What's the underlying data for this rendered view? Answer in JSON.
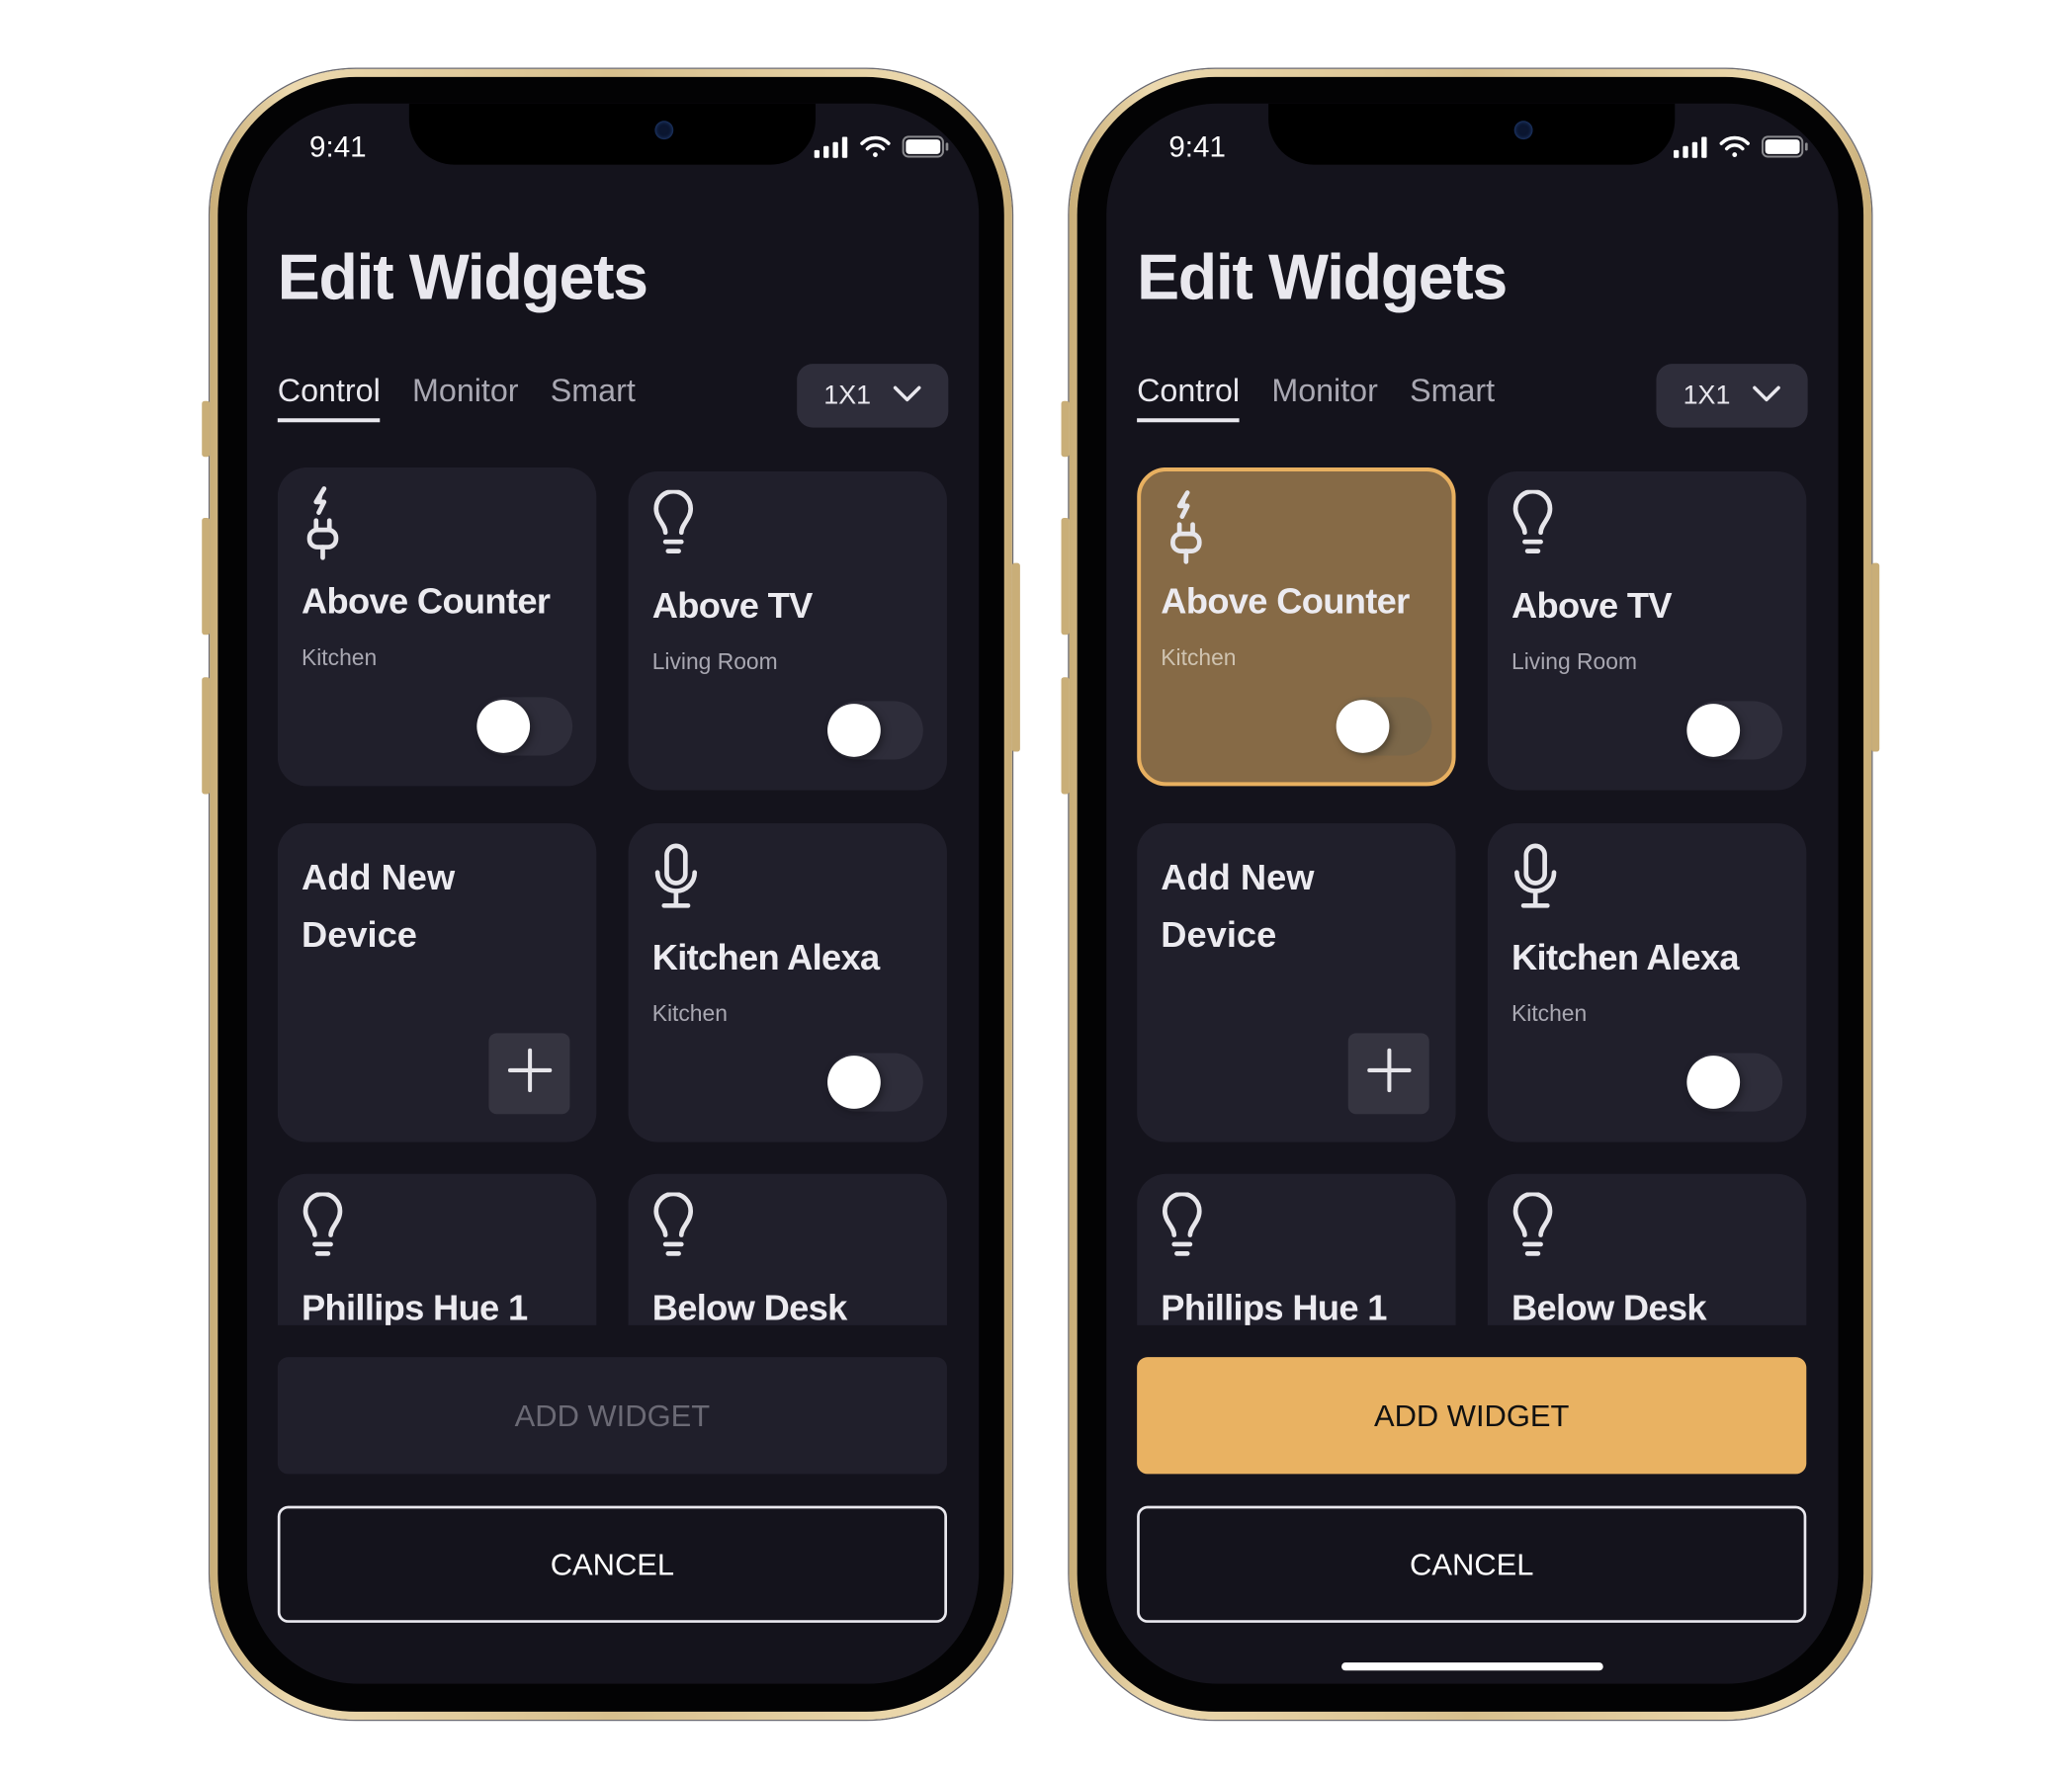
{
  "colors": {
    "screen_bg": "#14131c",
    "card_bg": "#201f2b",
    "selected_card_bg": "#866a46",
    "accent": "#e9b262",
    "disabled_button_bg": "#201f2b",
    "disabled_button_text": "#6b6a75"
  },
  "phones": [
    {
      "status": {
        "time": "9:41",
        "icons": [
          "cellular-signal-icon",
          "wifi-icon",
          "battery-icon"
        ]
      },
      "title": "Edit Widgets",
      "tabs": [
        {
          "label": "Control",
          "active": true
        },
        {
          "label": "Monitor",
          "active": false
        },
        {
          "label": "Smart",
          "active": false
        }
      ],
      "size_dropdown": {
        "value": "1X1",
        "icon": "chevron-down-icon"
      },
      "widgets": [
        {
          "type": "device",
          "icon": "plug-icon",
          "name": "Above Counter",
          "room": "Kitchen",
          "on": false,
          "selected": false
        },
        {
          "type": "device",
          "icon": "lightbulb-icon",
          "name": "Above TV",
          "room": "Living Room",
          "on": false,
          "selected": false
        },
        {
          "type": "add",
          "name": "Add New Device",
          "icon": "plus-icon"
        },
        {
          "type": "device",
          "icon": "microphone-icon",
          "name": "Kitchen Alexa",
          "room": "Kitchen",
          "on": false,
          "selected": false
        },
        {
          "type": "device",
          "icon": "lightbulb-icon",
          "name": "Phillips Hue 1",
          "selected": false
        },
        {
          "type": "device",
          "icon": "lightbulb-icon",
          "name": "Below Desk",
          "selected": false
        }
      ],
      "add_widget": {
        "label": "ADD WIDGET",
        "enabled": false
      },
      "cancel": {
        "label": "CANCEL"
      }
    },
    {
      "status": {
        "time": "9:41",
        "icons": [
          "cellular-signal-icon",
          "wifi-icon",
          "battery-icon"
        ]
      },
      "title": "Edit Widgets",
      "tabs": [
        {
          "label": "Control",
          "active": true
        },
        {
          "label": "Monitor",
          "active": false
        },
        {
          "label": "Smart",
          "active": false
        }
      ],
      "size_dropdown": {
        "value": "1X1",
        "icon": "chevron-down-icon"
      },
      "widgets": [
        {
          "type": "device",
          "icon": "plug-icon",
          "name": "Above Counter",
          "room": "Kitchen",
          "on": false,
          "selected": true
        },
        {
          "type": "device",
          "icon": "lightbulb-icon",
          "name": "Above TV",
          "room": "Living Room",
          "on": false,
          "selected": false
        },
        {
          "type": "add",
          "name": "Add New Device",
          "icon": "plus-icon"
        },
        {
          "type": "device",
          "icon": "microphone-icon",
          "name": "Kitchen Alexa",
          "room": "Kitchen",
          "on": false,
          "selected": false
        },
        {
          "type": "device",
          "icon": "lightbulb-icon",
          "name": "Phillips Hue 1",
          "selected": false
        },
        {
          "type": "device",
          "icon": "lightbulb-icon",
          "name": "Below Desk",
          "selected": false
        }
      ],
      "add_widget": {
        "label": "ADD WIDGET",
        "enabled": true
      },
      "cancel": {
        "label": "CANCEL"
      }
    }
  ]
}
